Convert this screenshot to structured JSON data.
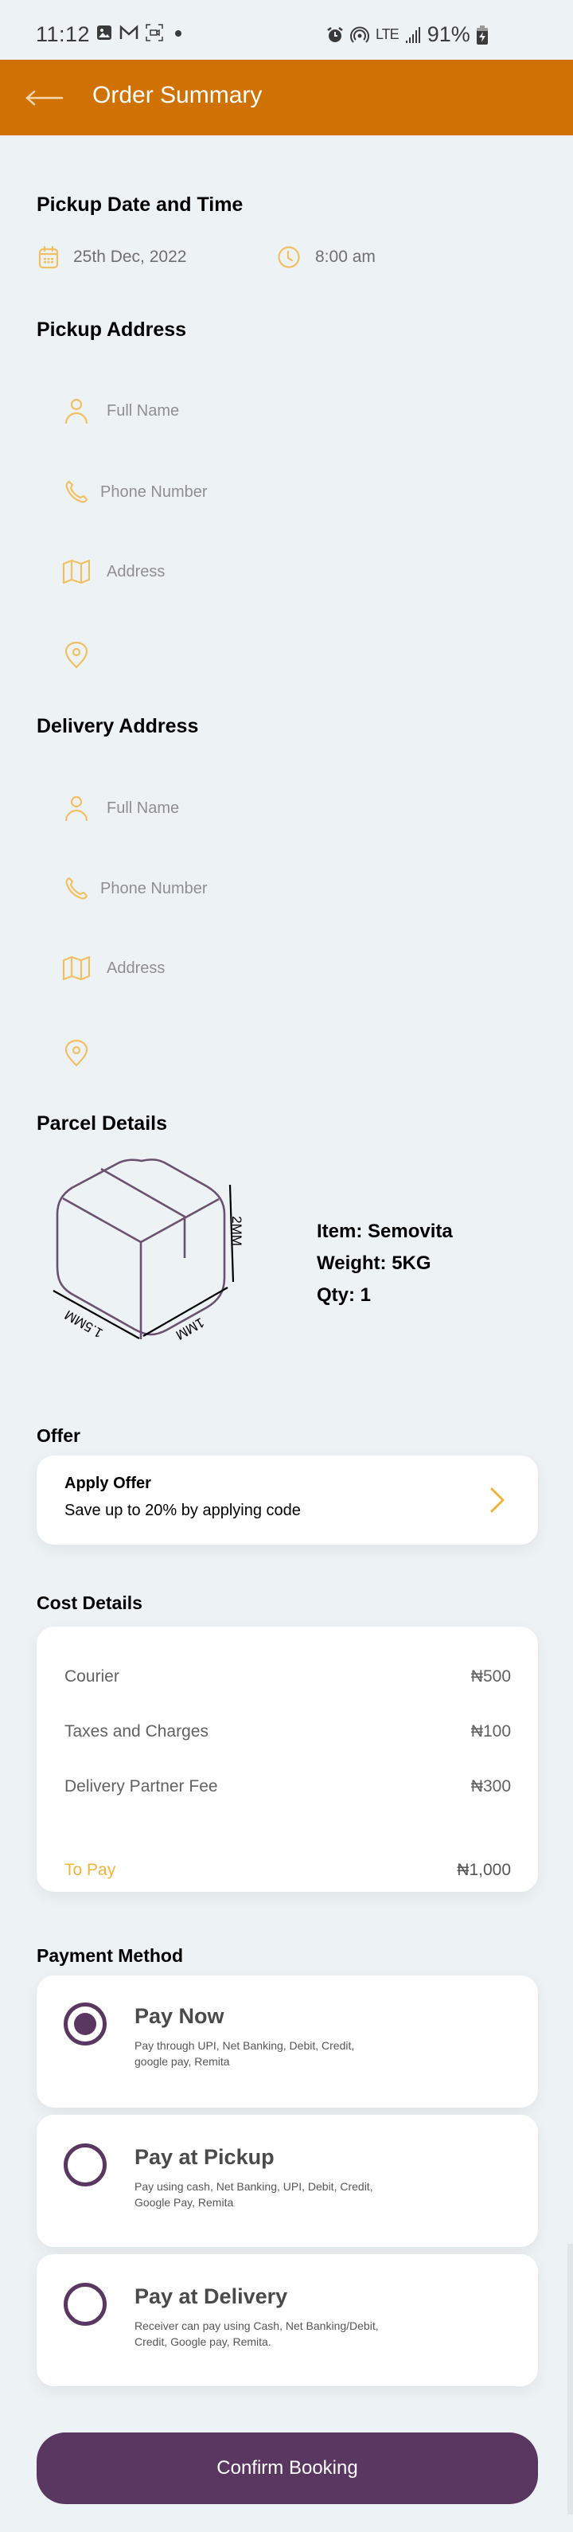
{
  "status_bar": {
    "time": "11:12",
    "left_icons": [
      "image-icon",
      "gmail-icon",
      "screen-record-icon",
      "dot-icon"
    ],
    "right_icons": [
      "alarm-icon",
      "hotspot-icon",
      "lte-icon",
      "signal-icon",
      "battery-charging-icon"
    ],
    "network": "LTE",
    "battery": "91%"
  },
  "app_bar": {
    "back_icon": "arrow-left-icon",
    "title": "Order Summary",
    "background": "#cf7203"
  },
  "pickup_datetime": {
    "title": "Pickup Date and Time",
    "date": "25th Dec, 2022",
    "time": "8:00 am"
  },
  "pickup_address": {
    "title": "Pickup Address",
    "fields": [
      {
        "icon": "user-icon",
        "placeholder": "Full Name",
        "value": ""
      },
      {
        "icon": "phone-icon",
        "placeholder": "Phone Number",
        "value": ""
      },
      {
        "icon": "map-icon",
        "placeholder": "Address",
        "value": ""
      },
      {
        "icon": "location-pin-icon",
        "placeholder": "",
        "value": ""
      }
    ]
  },
  "delivery_address": {
    "title": "Delivery Address",
    "fields": [
      {
        "icon": "user-icon",
        "placeholder": "Full Name",
        "value": ""
      },
      {
        "icon": "phone-icon",
        "placeholder": "Phone Number",
        "value": ""
      },
      {
        "icon": "map-icon",
        "placeholder": "Address",
        "value": ""
      },
      {
        "icon": "location-pin-icon",
        "placeholder": "",
        "value": ""
      }
    ]
  },
  "parcel": {
    "title": "Parcel Details",
    "dimensions": {
      "height": "2MM",
      "width": "1MM",
      "length": "1.5MM"
    },
    "item": "Item: Semovita",
    "weight": "Weight: 5KG",
    "qty": "Qty: 1"
  },
  "offer": {
    "title": "Offer",
    "card_title": "Apply Offer",
    "card_subtitle": "Save up to 20% by applying code"
  },
  "cost": {
    "title": "Cost Details",
    "rows": [
      {
        "label": "Courier",
        "value": "₦500"
      },
      {
        "label": "Taxes and Charges",
        "value": "₦100"
      },
      {
        "label": "Delivery Partner Fee",
        "value": "₦300"
      }
    ],
    "total": {
      "label": "To Pay",
      "value": "₦1,000"
    }
  },
  "payment": {
    "title": "Payment Method",
    "options": [
      {
        "title": "Pay Now",
        "description": "Pay through UPI, Net Banking, Debit, Credit, google pay, Remita",
        "selected": true
      },
      {
        "title": "Pay at Pickup",
        "description": "Pay using cash, Net Banking, UPI, Debit, Credit, Google Pay, Remita",
        "selected": false
      },
      {
        "title": "Pay at Delivery",
        "description": "Receiver can pay using Cash, Net Banking/Debit, Credit, Google pay, Remita.",
        "selected": false
      }
    ]
  },
  "confirm_button": "Confirm Booking",
  "colors": {
    "primary": "#5a3760",
    "accent": "#f2b33d",
    "header": "#cf7203",
    "background": "#edf2f5"
  }
}
